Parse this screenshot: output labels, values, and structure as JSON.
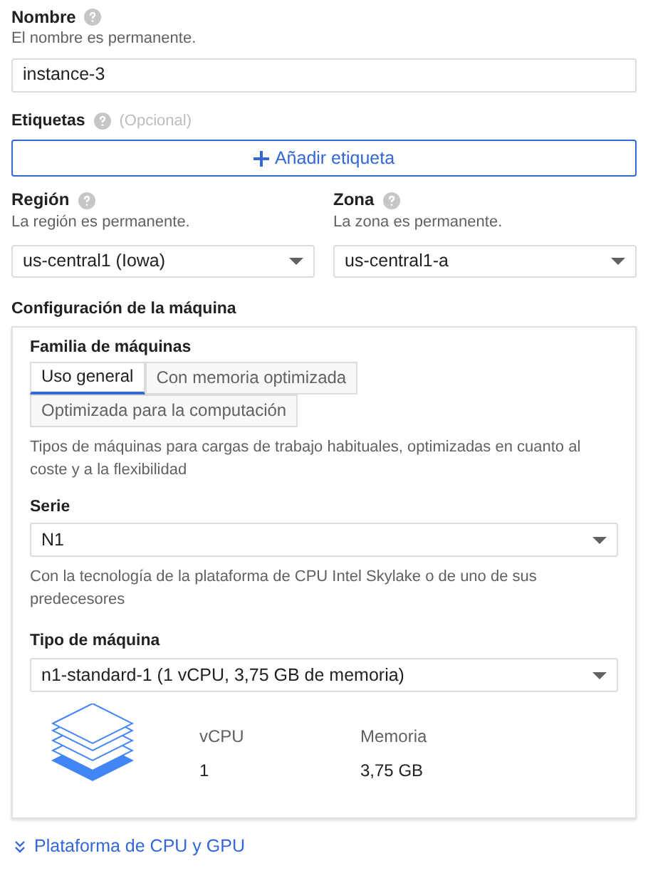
{
  "name_field": {
    "label": "Nombre",
    "hint": "El nombre es permanente.",
    "value": "instance-3"
  },
  "labels": {
    "label": "Etiquetas",
    "optional": "(Opcional)",
    "button": "Añadir etiqueta"
  },
  "region": {
    "label": "Región",
    "hint": "La región es permanente.",
    "value": "us-central1 (Iowa)"
  },
  "zone": {
    "label": "Zona",
    "hint": "La zona es permanente.",
    "value": "us-central1-a"
  },
  "machine_config": {
    "title": "Configuración de la máquina",
    "family": {
      "label": "Familia de máquinas",
      "tabs": [
        {
          "label": "Uso general",
          "selected": true
        },
        {
          "label": "Con memoria optimizada",
          "selected": false
        },
        {
          "label": "Optimizada para la computación",
          "selected": false
        }
      ],
      "description": "Tipos de máquinas para cargas de trabajo habituales, optimizadas en cuanto al coste y a la flexibilidad"
    },
    "series": {
      "label": "Serie",
      "value": "N1",
      "description": "Con la tecnología de la plataforma de CPU Intel Skylake o de uno de sus predecesores"
    },
    "machine_type": {
      "label": "Tipo de máquina",
      "value": "n1-standard-1 (1 vCPU, 3,75 GB de memoria)"
    },
    "specs": [
      {
        "label": "vCPU",
        "value": "1"
      },
      {
        "label": "Memoria",
        "value": "3,75 GB"
      }
    ]
  },
  "expand_link": "Plataforma de CPU y GPU"
}
